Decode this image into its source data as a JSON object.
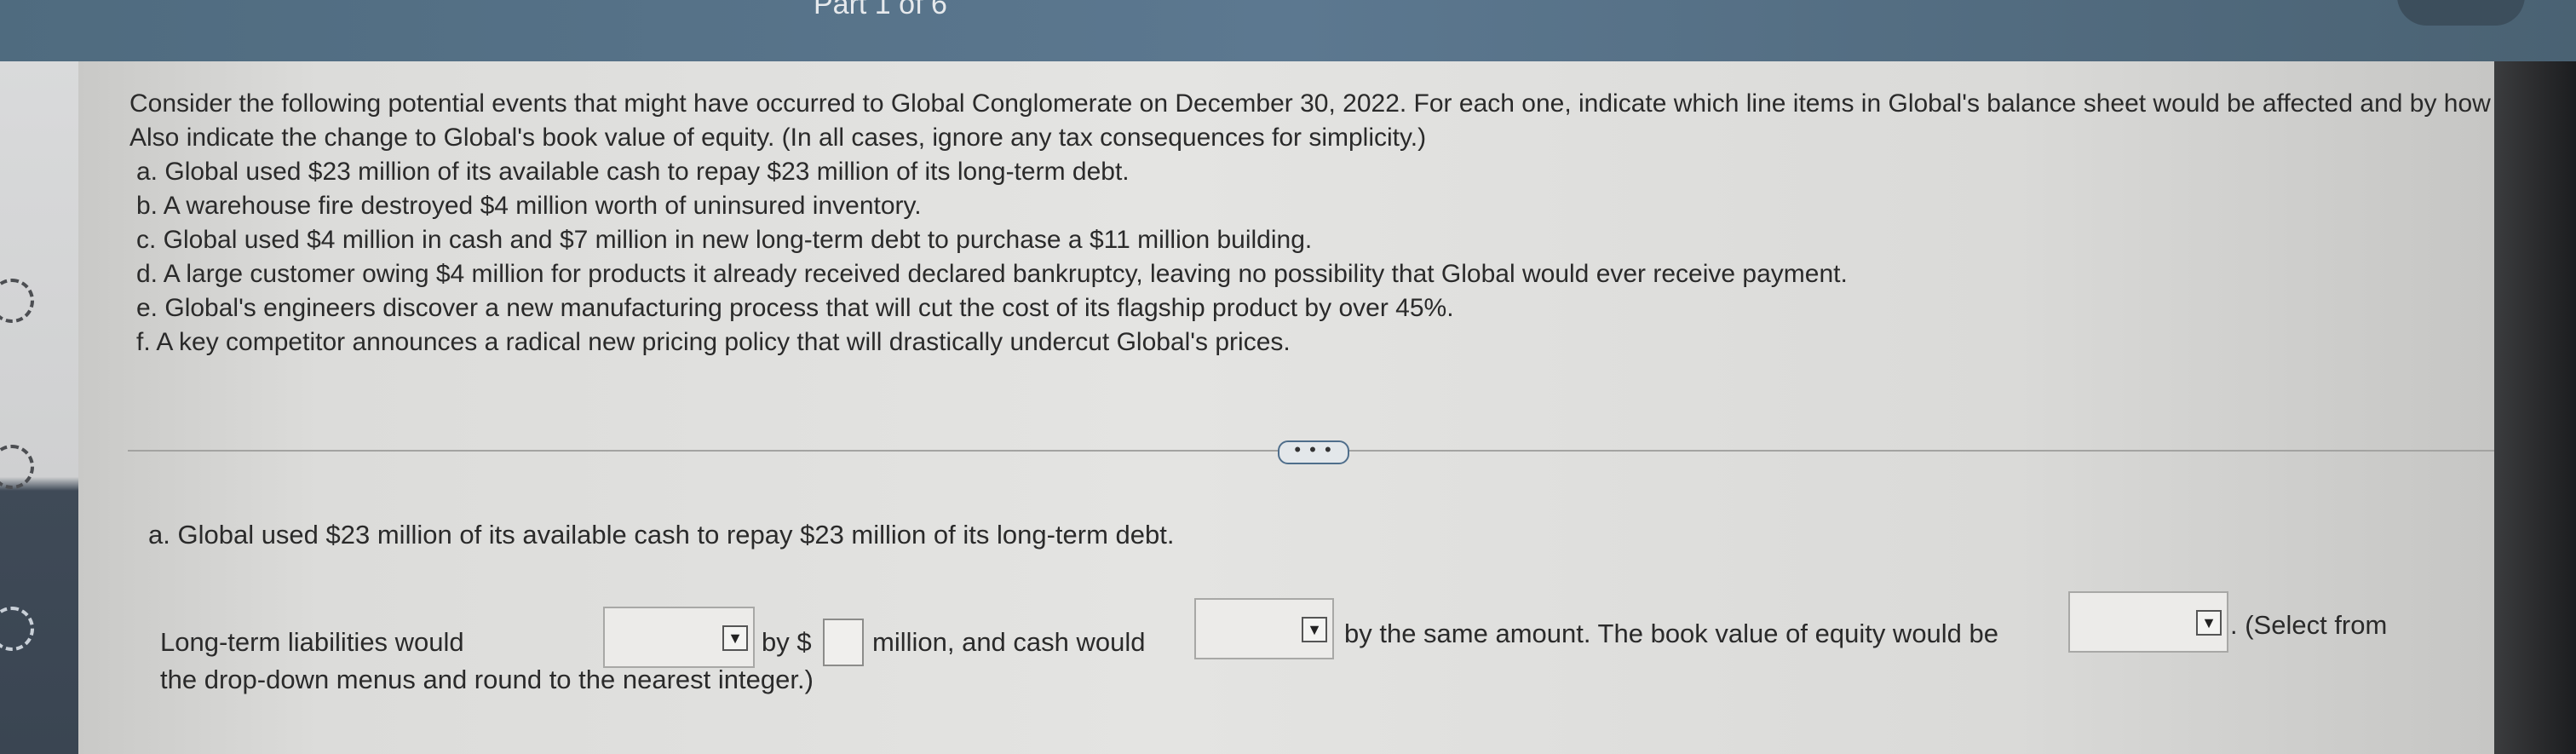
{
  "header": {
    "part_label": "Part 1 of 6"
  },
  "question": {
    "intro": "Consider the following potential events that might have occurred to Global Conglomerate on December 30, 2022. For each one, indicate which line items in Global's balance sheet would be affected and by how much. Also indicate the change to Global's book value of equity. (In all cases, ignore any tax consequences for simplicity.)",
    "items": [
      "a. Global used $23 million of its available cash to repay $23 million of its long-term debt.",
      "b. A warehouse fire destroyed $4 million worth of uninsured inventory.",
      "c. Global used $4 million in cash and $7 million in new long-term debt to purchase a $11 million building.",
      "d. A large customer owing $4 million for products it already received declared bankruptcy, leaving no possibility that Global would ever receive payment.",
      "e. Global's engineers discover a new manufacturing process that will cut the cost of its flagship product by over 45%.",
      "f. A key competitor announces a radical new pricing policy that will drastically undercut Global's prices."
    ]
  },
  "expand_button": {
    "label": "• • •"
  },
  "part_a": {
    "title": "a. Global used $23 million of its available cash to repay $23 million of its long-term debt.",
    "text_1": "Long-term liabilities would",
    "text_2": "by $",
    "text_3": "million, and cash would",
    "text_4": "by the same amount. The book value of equity would be",
    "text_5": ". (Select from",
    "text_6": "the drop-down menus and round to the nearest integer.)",
    "liabilities_dropdown_value": "",
    "amount_input_value": "",
    "cash_dropdown_value": "",
    "equity_dropdown_value": ""
  },
  "icons": {
    "dropdown_caret": "dropdown-caret-icon",
    "rail_icon": "progress-circle-icon"
  }
}
